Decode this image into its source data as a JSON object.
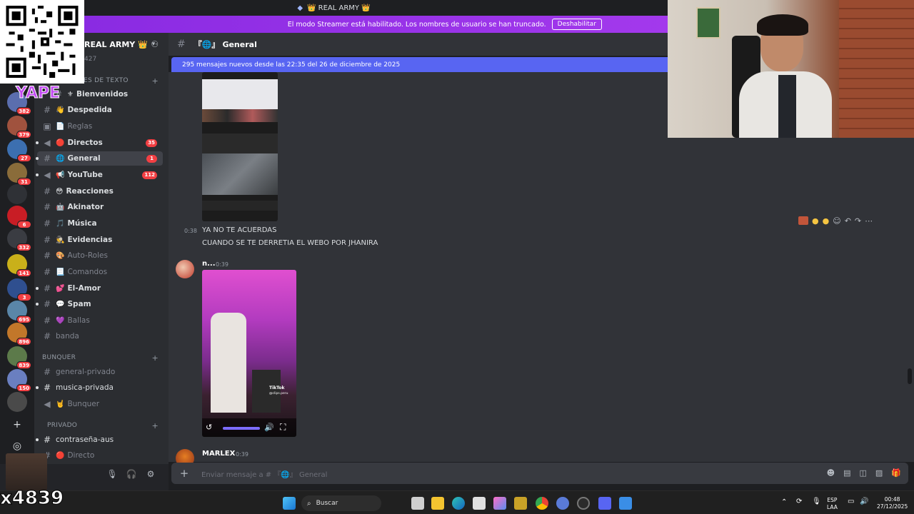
{
  "window": {
    "title": "👑 REAL ARMY 👑",
    "server_icon": "server-shield-icon"
  },
  "streamer_banner": {
    "text": "El modo Streamer está habilitado. Los nombres de usuario se han truncado.",
    "button": "Deshabilitar"
  },
  "overlay": {
    "yape": "YAPE",
    "handle": "x4839"
  },
  "guild": {
    "name": "REAL ARMY 👑",
    "sub": "427"
  },
  "server_badges": [
    "382",
    "379",
    "27",
    "31",
    "6",
    "332",
    "141",
    "3",
    "695",
    "896",
    "839",
    "150"
  ],
  "categories": {
    "text": "ES DE TEXTO",
    "bunquer": "BUNQUER",
    "privado": "PRIVADO"
  },
  "channels": [
    {
      "emoji": "⚜",
      "label": "Bienvenidos"
    },
    {
      "emoji": "👋",
      "label": "Despedida"
    },
    {
      "emoji": "📄",
      "label": "Reglas"
    },
    {
      "emoji": "🔴",
      "label": "Directos",
      "badge": "35"
    },
    {
      "emoji": "🌐",
      "label": "General",
      "badge": "1"
    },
    {
      "emoji": "📢",
      "label": "YouTube",
      "badge": "112"
    },
    {
      "emoji": "😳",
      "label": "Reacciones"
    },
    {
      "emoji": "🤖",
      "label": "Akinator"
    },
    {
      "emoji": "🎵",
      "label": "Música"
    },
    {
      "emoji": "🕵",
      "label": "Evidencias"
    },
    {
      "emoji": "🎨",
      "label": "Auto-Roles"
    },
    {
      "emoji": "📃",
      "label": "Comandos"
    },
    {
      "emoji": "💕",
      "label": "El-Amor"
    },
    {
      "emoji": "💬",
      "label": "Spam"
    },
    {
      "emoji": "💜",
      "label": "Ballas"
    },
    {
      "emoji": "",
      "label": "banda"
    }
  ],
  "bunquer_channels": [
    {
      "label": "general-privado"
    },
    {
      "label": "musica-privada"
    },
    {
      "emoji": "🤘",
      "label": "Bunquer"
    }
  ],
  "privado_channels": [
    {
      "label": "contraseña-aus"
    },
    {
      "emoji": "🔴",
      "label": "Directo"
    }
  ],
  "chat": {
    "channel": "General",
    "channel_prefix": "『🌐』",
    "new_messages": "295 mensajes nuevos desde las 22:35 del 26 de diciembre de 2025",
    "messages": [
      {
        "time": "0:38",
        "lines": [
          "YA NO TE ACUERDAS",
          "CUANDO SE TE DERRETIA EL WEBO POR JHANIRA"
        ]
      },
      {
        "author": "n...",
        "time": "0:39"
      },
      {
        "author": "MARLEX",
        "time": "0:39"
      }
    ],
    "video_overlay": {
      "brand": "TikTok",
      "handle": "@clips.peru"
    },
    "composer_placeholder": "Enviar mensaje a # 『🌐』 General"
  },
  "taskbar": {
    "search": "Buscar",
    "lang": "ESP",
    "region": "LAA",
    "time": "00:48",
    "date": "27/12/2025"
  }
}
